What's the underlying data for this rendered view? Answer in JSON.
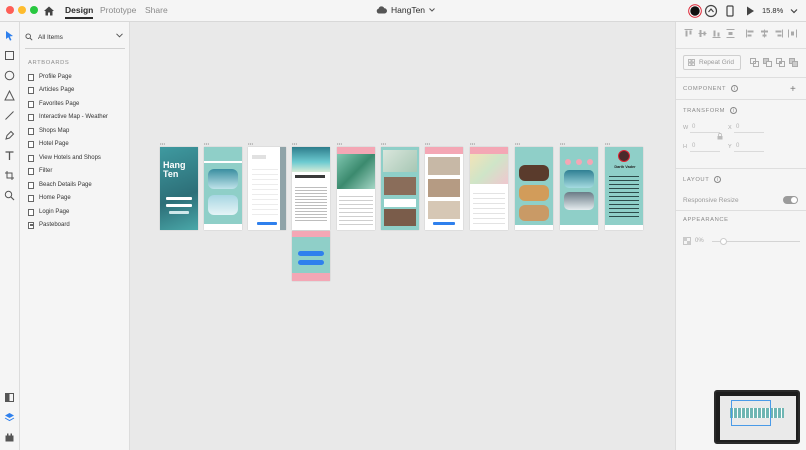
{
  "window": {
    "tabs": [
      {
        "label": "Design",
        "active": true
      },
      {
        "label": "Prototype",
        "active": false
      },
      {
        "label": "Share",
        "active": false
      }
    ],
    "document_title": "HangTen",
    "zoom": "15.8%"
  },
  "layers_panel": {
    "filter_label": "All Items",
    "section_title": "ARTBOARDS",
    "items": [
      {
        "label": "Profile Page"
      },
      {
        "label": "Articles Page"
      },
      {
        "label": "Favorites Page"
      },
      {
        "label": "Interactive Map - Weather"
      },
      {
        "label": "Shops Map"
      },
      {
        "label": "Hotel Page"
      },
      {
        "label": "View Hotels and Shops"
      },
      {
        "label": "Filter"
      },
      {
        "label": "Beach Details Page"
      },
      {
        "label": "Home Page"
      },
      {
        "label": "Login Page"
      },
      {
        "label": "Pasteboard"
      }
    ]
  },
  "canvas": {
    "login_title": "Hang Ten",
    "profile_name": "Darth Vader"
  },
  "properties": {
    "repeat_grid_label": "Repeat Grid",
    "component_title": "COMPONENT",
    "transform_title": "TRANSFORM",
    "w_label": "W",
    "w_value": "0",
    "x_label": "X",
    "x_value": "0",
    "h_label": "H",
    "h_value": "0",
    "y_label": "Y",
    "y_value": "0",
    "layout_title": "LAYOUT",
    "responsive_resize_label": "Responsive Resize",
    "appearance_title": "APPEARANCE",
    "opacity_value": "0%"
  },
  "colors": {
    "teal": "#6fb6b3",
    "ocean": "#3d8f97",
    "pink": "#f4a7b5",
    "accent_blue": "#2f80ed"
  }
}
